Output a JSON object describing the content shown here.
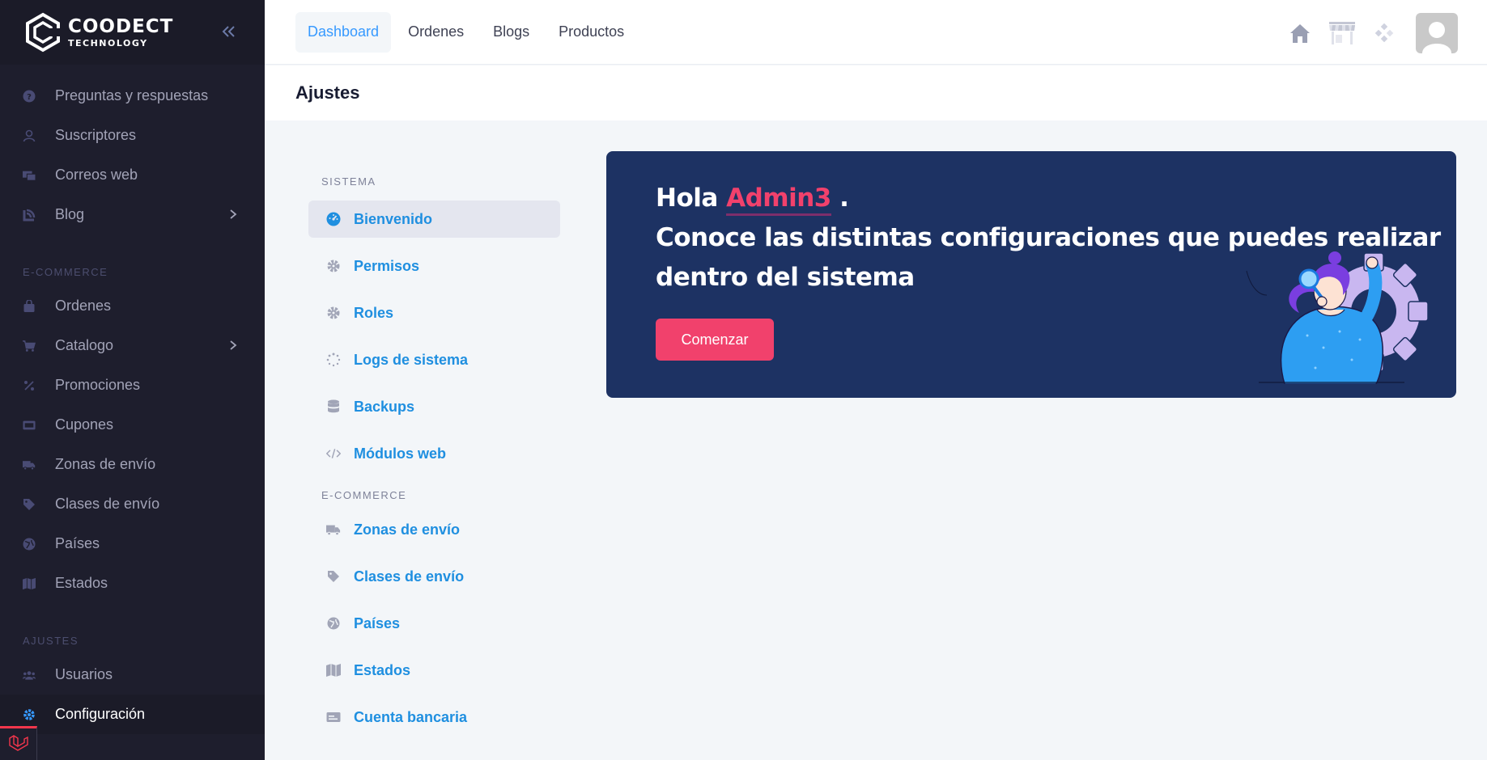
{
  "brand": {
    "line1": "COODECT",
    "line2": "TECHNOLOGY"
  },
  "sidebar": {
    "items_top": [
      {
        "label": "Preguntas y respuestas",
        "icon": "question-circle-icon"
      },
      {
        "label": "Suscriptores",
        "icon": "user-icon"
      },
      {
        "label": "Correos web",
        "icon": "mail-icon"
      },
      {
        "label": "Blog",
        "icon": "blog-icon",
        "has_children": true
      }
    ],
    "section_ecommerce": "E-COMMERCE",
    "items_ecommerce": [
      {
        "label": "Ordenes",
        "icon": "shopping-bag-icon"
      },
      {
        "label": "Catalogo",
        "icon": "cart-icon",
        "has_children": true
      },
      {
        "label": "Promociones",
        "icon": "percent-icon"
      },
      {
        "label": "Cupones",
        "icon": "coupon-icon"
      },
      {
        "label": "Zonas de envío",
        "icon": "truck-icon"
      },
      {
        "label": "Clases de envío",
        "icon": "tag-icon"
      },
      {
        "label": "Países",
        "icon": "globe-icon"
      },
      {
        "label": "Estados",
        "icon": "map-icon"
      }
    ],
    "section_ajustes": "AJUSTES",
    "items_ajustes": [
      {
        "label": "Usuarios",
        "icon": "users-icon"
      },
      {
        "label": "Configuración",
        "icon": "gear-icon",
        "active": true
      }
    ]
  },
  "topbar": {
    "tabs": [
      {
        "label": "Dashboard",
        "active": true
      },
      {
        "label": "Ordenes"
      },
      {
        "label": "Blogs"
      },
      {
        "label": "Productos"
      }
    ]
  },
  "page_title": "Ajustes",
  "settings_nav": {
    "section_sistema": "SISTEMA",
    "sistema": [
      {
        "label": "Bienvenido",
        "icon": "dashboard-icon",
        "active": true
      },
      {
        "label": "Permisos",
        "icon": "gear-icon"
      },
      {
        "label": "Roles",
        "icon": "gear-icon"
      },
      {
        "label": "Logs de sistema",
        "icon": "spinner-icon"
      },
      {
        "label": "Backups",
        "icon": "database-icon"
      },
      {
        "label": "Módulos web",
        "icon": "code-icon"
      }
    ],
    "section_ecommerce": "E-COMMERCE",
    "ecommerce": [
      {
        "label": "Zonas de envío",
        "icon": "truck-icon"
      },
      {
        "label": "Clases de envío",
        "icon": "tag-icon"
      },
      {
        "label": "Países",
        "icon": "globe-icon"
      },
      {
        "label": "Estados",
        "icon": "map-icon"
      },
      {
        "label": "Cuenta bancaria",
        "icon": "credit-card-icon"
      }
    ]
  },
  "hero": {
    "greeting": "Hola",
    "name": "Admin3",
    "dot": ".",
    "line2": "Conoce las distintas configuraciones que puedes realizar",
    "line3": "dentro del sistema",
    "button": "Comenzar"
  },
  "colors": {
    "sidebar_bg": "#1e1e2d",
    "accent_blue": "#3699ff",
    "hero_bg": "#1d3263",
    "accent_pink": "#f1416c"
  }
}
